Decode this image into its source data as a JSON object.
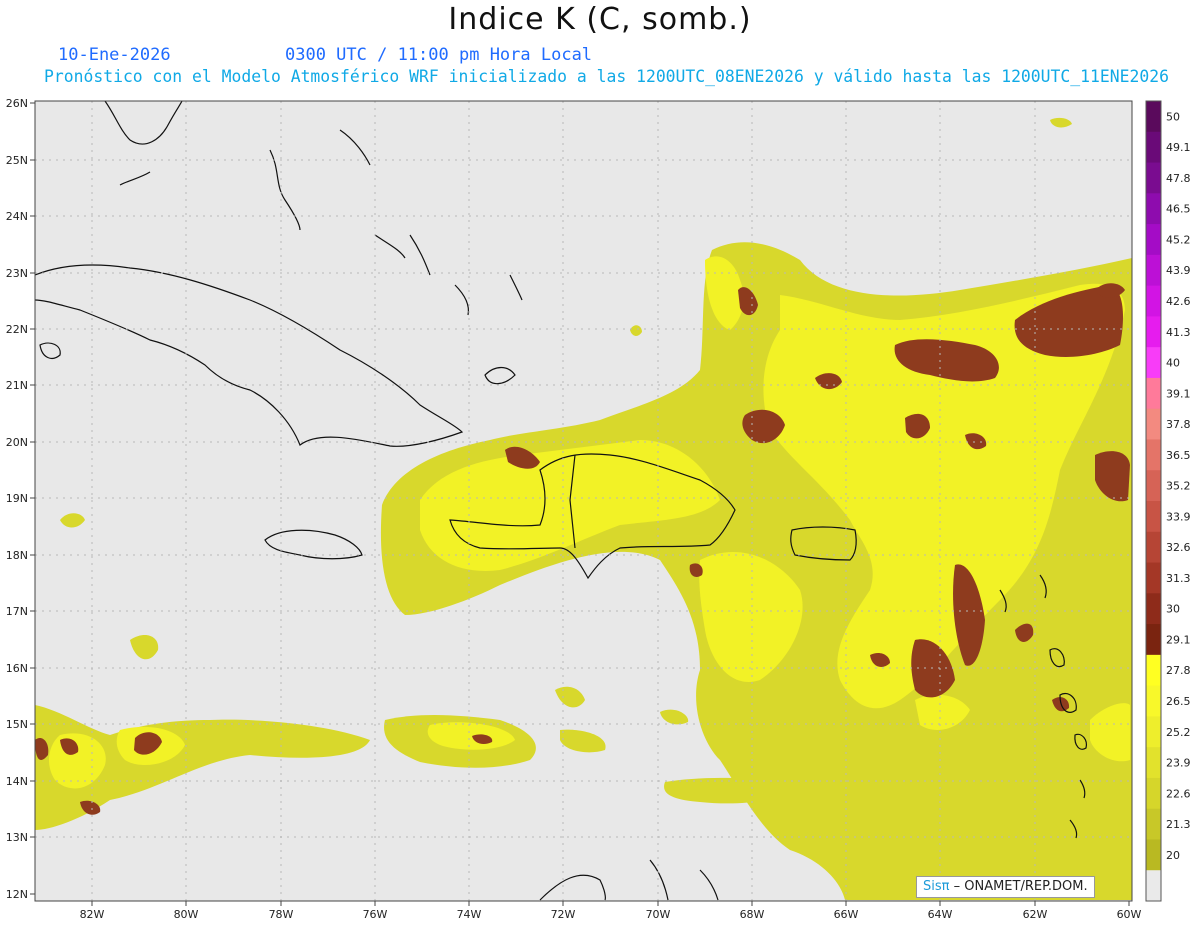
{
  "header": {
    "title": "Indice K (C, somb.)",
    "date": "10-Ene-2026",
    "time": "0300 UTC / 11:00 pm Hora Local",
    "model_line": "Pronóstico con el Modelo Atmosférico WRF inicializado a las 1200UTC_08ENE2026 y válido hasta las  1200UTC_11ENE2026"
  },
  "map": {
    "lon_labels": [
      "82W",
      "80W",
      "78W",
      "76W",
      "74W",
      "72W",
      "70W",
      "68W",
      "66W",
      "64W",
      "62W",
      "60W"
    ],
    "lat_labels": [
      "26N",
      "25N",
      "24N",
      "23N",
      "22N",
      "21N",
      "20N",
      "19N",
      "18N",
      "17N",
      "16N",
      "15N",
      "14N",
      "13N",
      "12N"
    ],
    "lon_range": [
      -83.2,
      -59.9
    ],
    "lat_range": [
      11.9,
      26.1
    ],
    "background_color": "#e8e8e8",
    "grid": true
  },
  "colorbar": {
    "labels": [
      "50",
      "49.1",
      "47.8",
      "46.5",
      "45.2",
      "43.9",
      "42.6",
      "41.3",
      "40",
      "39.1",
      "37.8",
      "36.5",
      "35.2",
      "33.9",
      "32.6",
      "31.3",
      "30",
      "29.1",
      "27.8",
      "26.5",
      "25.2",
      "23.9",
      "22.6",
      "21.3",
      "20"
    ],
    "colors": [
      "#5a0a5c",
      "#6a0a78",
      "#7a0c90",
      "#8e0cae",
      "#a40cc6",
      "#bc10d6",
      "#d214e4",
      "#e61cee",
      "#f83cf8",
      "#ff7a9a",
      "#f38a80",
      "#e47468",
      "#d66356",
      "#c85445",
      "#b64535",
      "#a43726",
      "#8e2b1a",
      "#7a2410",
      "#ffff22",
      "#f8f82a",
      "#eeee2c",
      "#e2e22c",
      "#d6d62a",
      "#c8c828",
      "#b9b922",
      "#eaeaea"
    ]
  },
  "credit": {
    "brand": "Sisπ",
    "text": " – ONAMET/REP.DOM."
  }
}
